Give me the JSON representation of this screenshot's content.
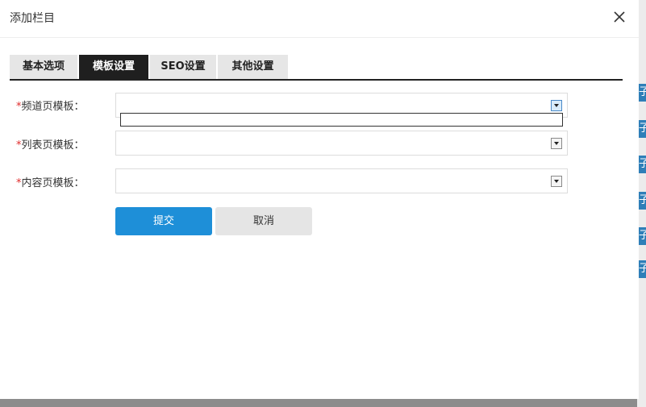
{
  "dialog": {
    "title": "添加栏目",
    "close_icon": "close-icon"
  },
  "tabs": [
    {
      "label": "基本选项",
      "active": false
    },
    {
      "label": "模板设置",
      "active": true
    },
    {
      "label": "SEO设置",
      "active": false
    },
    {
      "label": "其他设置",
      "active": false
    }
  ],
  "form": {
    "required_mark": "*",
    "fields": [
      {
        "label": "频道页模板：",
        "value": "",
        "open": true
      },
      {
        "label": "列表页模板：",
        "value": ""
      },
      {
        "label": "内容页模板：",
        "value": ""
      }
    ],
    "submit_label": "提交",
    "cancel_label": "取消"
  },
  "background": {
    "tag_text": "子"
  },
  "colors": {
    "primary": "#1e8fd8",
    "active_tab": "#1f1f1f",
    "required": "#e02b2b"
  }
}
